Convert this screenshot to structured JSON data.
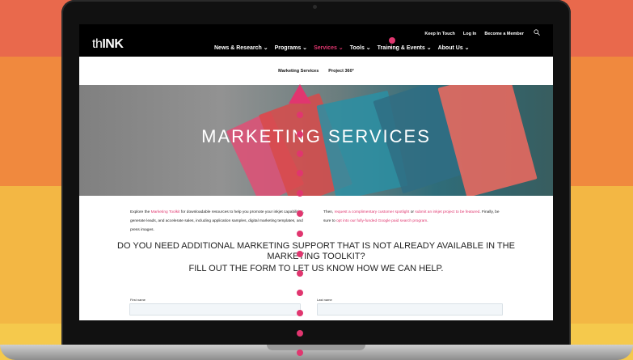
{
  "header": {
    "logo": {
      "prefix": "th",
      "bold": "INK",
      "dot": "."
    },
    "utility_links": [
      "Keep In Touch",
      "Log In",
      "Become a Member"
    ],
    "nav": [
      {
        "label": "News & Research ⌄",
        "active": false
      },
      {
        "label": "Programs ⌄",
        "active": false
      },
      {
        "label": "Services ⌄",
        "active": true
      },
      {
        "label": "Tools ⌄",
        "active": false
      },
      {
        "label": "Training & Events ⌄",
        "active": false
      },
      {
        "label": "About Us ⌄",
        "active": false
      }
    ]
  },
  "subnav": [
    "Marketing Services",
    "Project 360°"
  ],
  "hero": {
    "title": "MARKETING SERVICES"
  },
  "content": {
    "left_parts": [
      "Explore the ",
      "Marketing Toolkit",
      " for downloadable resources to help you promote your inkjet capabilities, generate leads, and accelerate sales, including application samples, digital marketing templates, and press images."
    ],
    "right_parts": [
      "Then, ",
      "request a complimentary customer spotlight",
      " or ",
      "submit an inkjet project to be featured",
      ". Finally, be sure to ",
      "opt into our fully-funded Google paid search program",
      "."
    ],
    "question_line1": "DO YOU NEED ADDITIONAL MARKETING SUPPORT THAT IS NOT ALREADY AVAILABLE IN THE MARKETING TOOLKIT?",
    "question_line2": "FILL OUT THE FORM TO LET US KNOW HOW WE CAN HELP."
  },
  "form": {
    "first_name_label": "First name",
    "last_name_label": "Last name"
  },
  "colors": {
    "accent": "#e0366f",
    "header_bg": "#000000"
  }
}
